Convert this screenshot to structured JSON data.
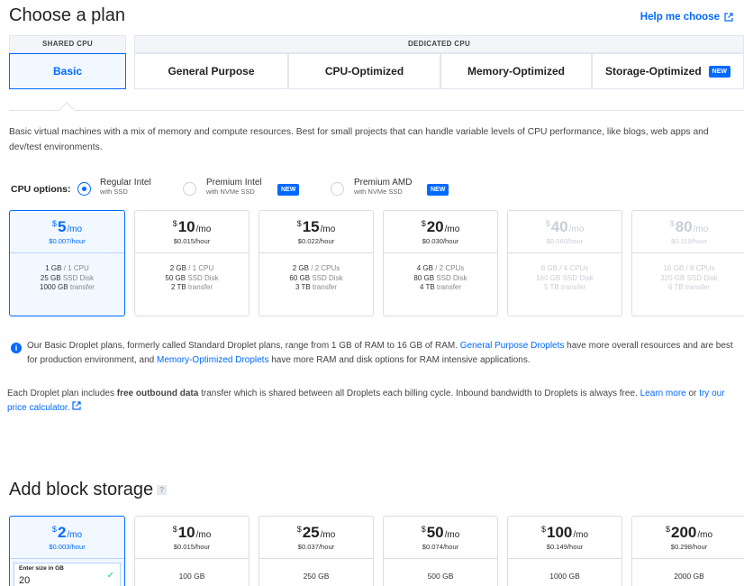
{
  "header": {
    "title": "Choose a plan",
    "help": "Help me choose"
  },
  "groups": {
    "shared": "SHARED CPU",
    "dedicated": "DEDICATED CPU"
  },
  "tabs": [
    {
      "label": "Basic",
      "active": true
    },
    {
      "label": "General Purpose"
    },
    {
      "label": "CPU-Optimized"
    },
    {
      "label": "Memory-Optimized"
    },
    {
      "label": "Storage-Optimized",
      "badge": "NEW"
    }
  ],
  "description": "Basic virtual machines with a mix of memory and compute resources. Best for small projects that can handle variable levels of CPU performance, like blogs, web apps and dev/test environments.",
  "cpu": {
    "label": "CPU options:",
    "options": [
      {
        "main": "Regular Intel",
        "sub": "with SSD",
        "selected": true
      },
      {
        "main": "Premium Intel",
        "sub": "with NVMe SSD",
        "badge": "NEW"
      },
      {
        "main": "Premium AMD",
        "sub": "with NVMe SSD",
        "badge": "NEW"
      }
    ]
  },
  "plans": [
    {
      "currency": "$",
      "amount": "5",
      "per": "/mo",
      "hourly": "$0.007/hour",
      "mem": "1 GB",
      "cpu": "/ 1 CPU",
      "disk": "25 GB",
      "disk_unit": "SSD Disk",
      "transfer": "1000 GB",
      "transfer_unit": "transfer",
      "selected": true
    },
    {
      "currency": "$",
      "amount": "10",
      "per": "/mo",
      "hourly": "$0.015/hour",
      "mem": "2 GB",
      "cpu": "/ 1 CPU",
      "disk": "50 GB",
      "disk_unit": "SSD Disk",
      "transfer": "2 TB",
      "transfer_unit": "transfer"
    },
    {
      "currency": "$",
      "amount": "15",
      "per": "/mo",
      "hourly": "$0.022/hour",
      "mem": "2 GB",
      "cpu": "/ 2 CPUs",
      "disk": "60 GB",
      "disk_unit": "SSD Disk",
      "transfer": "3 TB",
      "transfer_unit": "transfer"
    },
    {
      "currency": "$",
      "amount": "20",
      "per": "/mo",
      "hourly": "$0.030/hour",
      "mem": "4 GB",
      "cpu": "/ 2 CPUs",
      "disk": "80 GB",
      "disk_unit": "SSD Disk",
      "transfer": "4 TB",
      "transfer_unit": "transfer"
    },
    {
      "currency": "$",
      "amount": "40",
      "per": "/mo",
      "hourly": "$0.060/hour",
      "mem": "8 GB",
      "cpu": "/ 4 CPUs",
      "disk": "160 GB",
      "disk_unit": "SSD Disk",
      "transfer": "5 TB",
      "transfer_unit": "transfer",
      "dim": true
    },
    {
      "currency": "$",
      "amount": "80",
      "per": "/mo",
      "hourly": "$0.119/hour",
      "mem": "16 GB",
      "cpu": "/ 8 CPUs",
      "disk": "320 GB",
      "disk_unit": "SSD Disk",
      "transfer": "6 TB",
      "transfer_unit": "transfer",
      "dim": true
    }
  ],
  "info": {
    "part1": "Our Basic Droplet plans, formerly called Standard Droplet plans, range from 1 GB of RAM to 16 GB of RAM.",
    "link1": "General Purpose Droplets",
    "part2": "have more overall resources and are best for production environment, and",
    "link2": "Memory-Optimized Droplets",
    "part3": "have more RAM and disk options for RAM intensive applications."
  },
  "transfer_note": {
    "part1": "Each Droplet plan includes",
    "bold": "free outbound data",
    "part2": "transfer which is shared between all Droplets each billing cycle. Inbound bandwidth to Droplets is always free.",
    "link1": "Learn more",
    "or": "or",
    "link2": "try our price calculator."
  },
  "storage": {
    "title": "Add block storage",
    "help_mark": "?",
    "size_label": "Enter size in GB",
    "size_value": "20",
    "options": [
      {
        "currency": "$",
        "amount": "2",
        "per": "/mo",
        "hourly": "$0.003/hour",
        "size": "",
        "selected": true
      },
      {
        "currency": "$",
        "amount": "10",
        "per": "/mo",
        "hourly": "$0.015/hour",
        "size": "100 GB"
      },
      {
        "currency": "$",
        "amount": "25",
        "per": "/mo",
        "hourly": "$0.037/hour",
        "size": "250 GB"
      },
      {
        "currency": "$",
        "amount": "50",
        "per": "/mo",
        "hourly": "$0.074/hour",
        "size": "500 GB"
      },
      {
        "currency": "$",
        "amount": "100",
        "per": "/mo",
        "hourly": "$0.149/hour",
        "size": "1000 GB"
      },
      {
        "currency": "$",
        "amount": "200",
        "per": "/mo",
        "hourly": "$0.298/hour",
        "size": "2000 GB"
      }
    ]
  }
}
